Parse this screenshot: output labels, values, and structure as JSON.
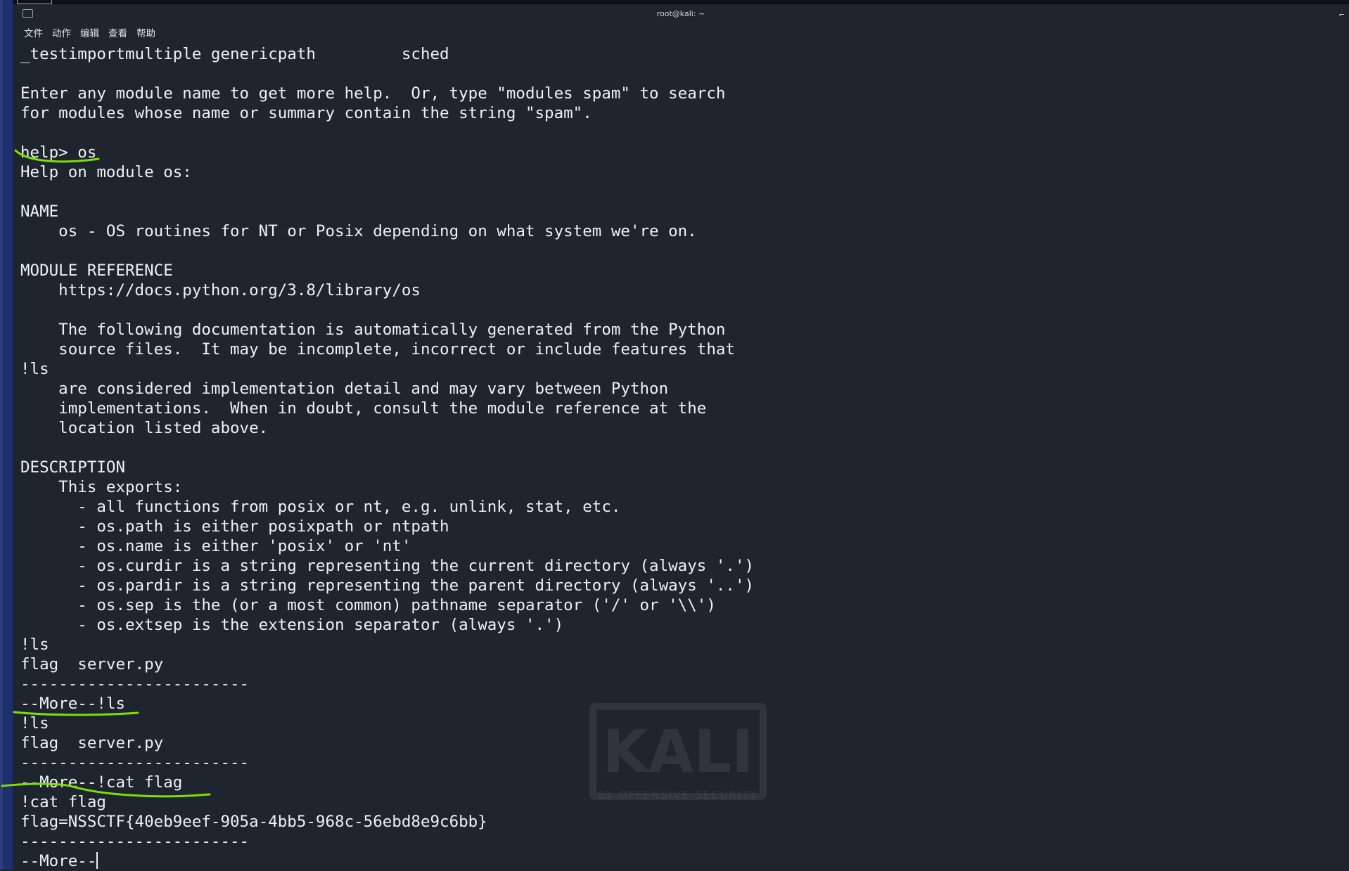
{
  "window": {
    "title": "root@kali: ~",
    "menu": [
      "文件",
      "动作",
      "编辑",
      "查看",
      "帮助"
    ]
  },
  "terminal": {
    "lines": [
      "_testimportmultiple genericpath         sched",
      "",
      "Enter any module name to get more help.  Or, type \"modules spam\" to search",
      "for modules whose name or summary contain the string \"spam\".",
      "",
      "help> os",
      "Help on module os:",
      "",
      "NAME",
      "    os - OS routines for NT or Posix depending on what system we're on.",
      "",
      "MODULE REFERENCE",
      "    https://docs.python.org/3.8/library/os",
      "",
      "    The following documentation is automatically generated from the Python",
      "    source files.  It may be incomplete, incorrect or include features that",
      "!ls",
      "    are considered implementation detail and may vary between Python",
      "    implementations.  When in doubt, consult the module reference at the",
      "    location listed above.",
      "",
      "DESCRIPTION",
      "    This exports:",
      "      - all functions from posix or nt, e.g. unlink, stat, etc.",
      "      - os.path is either posixpath or ntpath",
      "      - os.name is either 'posix' or 'nt'",
      "      - os.curdir is a string representing the current directory (always '.')",
      "      - os.pardir is a string representing the parent directory (always '..')",
      "      - os.sep is the (or a most common) pathname separator ('/' or '\\\\')",
      "      - os.extsep is the extension separator (always '.')",
      "!ls",
      "flag  server.py",
      "------------------------",
      "--More--!ls",
      "!ls",
      "flag  server.py",
      "------------------------",
      "--More--!cat flag",
      "!cat flag",
      "flag=NSSCTF{40eb9eef-905a-4bb5-968c-56ebd8e9c6bb}",
      "------------------------",
      "--More--"
    ]
  },
  "watermark": {
    "logo_text": "KALI",
    "sub_text": "BY OFFENSIVE SECURITY"
  },
  "colors": {
    "background": "#1f252e",
    "text": "#eef1f4",
    "annotation": "#7fe000"
  }
}
